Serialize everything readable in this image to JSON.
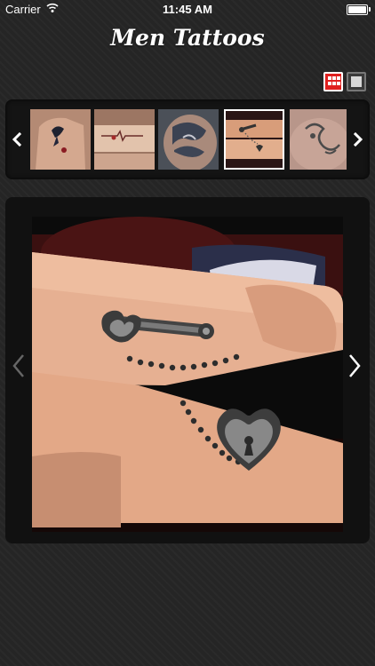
{
  "status_bar": {
    "carrier": "Carrier",
    "time": "11:45 AM",
    "battery_level": 1.0
  },
  "header": {
    "title": "Men Tattoos"
  },
  "view_toggle": {
    "grid_icon": "grid-icon",
    "single_icon": "single-view-icon",
    "active": "grid"
  },
  "thumbnails": {
    "prev_icon": "chevron-left-icon",
    "next_icon": "chevron-right-icon",
    "selected_index": 3,
    "count": 5
  },
  "viewer": {
    "prev_icon": "chevron-left-icon",
    "next_icon": "chevron-right-icon"
  },
  "colors": {
    "accent": "#e0201f",
    "background": "#252525",
    "panel": "#141414"
  }
}
